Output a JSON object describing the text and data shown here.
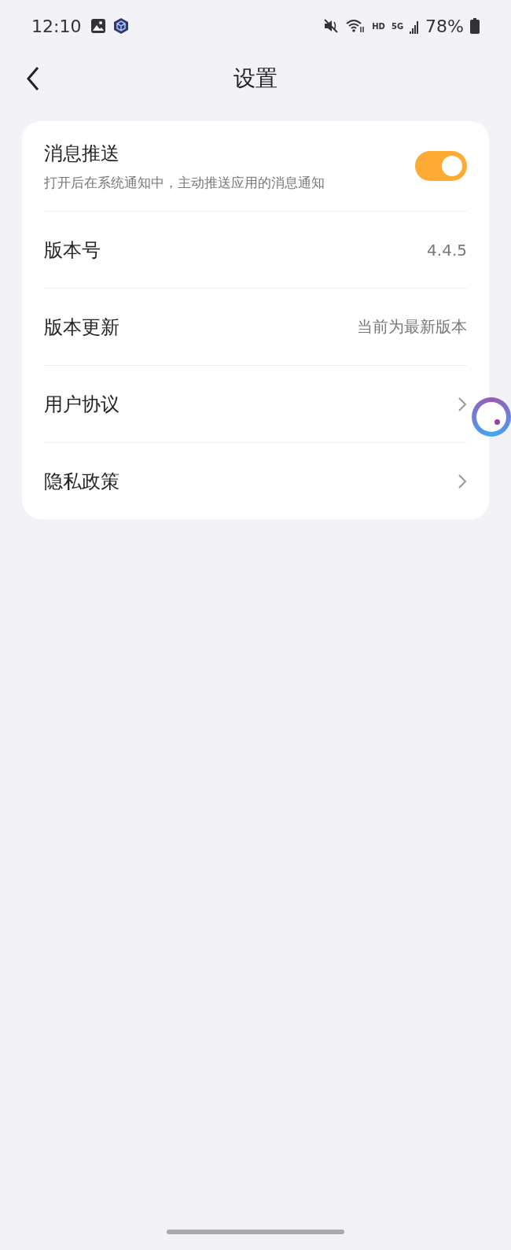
{
  "status_bar": {
    "time": "12:10",
    "hd": "HD",
    "network": "5G",
    "battery": "78%"
  },
  "header": {
    "title": "设置"
  },
  "settings": [
    {
      "kind": "toggle",
      "label": "消息推送",
      "description": "打开后在系统通知中，主动推送应用的消息通知",
      "on": true
    },
    {
      "kind": "value",
      "label": "版本号",
      "value": "4.4.5"
    },
    {
      "kind": "value",
      "label": "版本更新",
      "value": "当前为最新版本"
    },
    {
      "kind": "link",
      "label": "用户协议"
    },
    {
      "kind": "link",
      "label": "隐私政策"
    }
  ]
}
